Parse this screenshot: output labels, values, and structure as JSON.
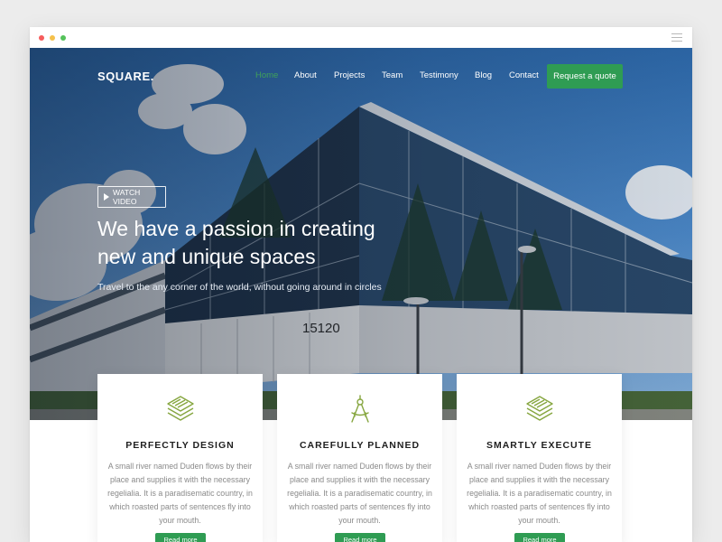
{
  "window": {
    "menu_icon": "hamburger-icon"
  },
  "nav": {
    "logo": "SQUARE.",
    "links": [
      "Home",
      "About",
      "Projects",
      "Team",
      "Testimony",
      "Blog",
      "Contact"
    ],
    "active": "Home",
    "cta": "Request a quote"
  },
  "hero": {
    "watch_video": "WATCH VIDEO",
    "title_line1": "We have a passion in creating",
    "title_line2": "new and unique spaces",
    "subtitle": "Travel to the any corner of the world, without going around in circles",
    "building_number": "15120"
  },
  "features": [
    {
      "icon": "layers-icon",
      "title": "PERFECTLY DESIGN",
      "description": "A small river named Duden flows by their place and supplies it with the necessary regelialia. It is a paradisematic country, in which roasted parts of sentences fly into your mouth.",
      "button": "Read more"
    },
    {
      "icon": "compass-icon",
      "title": "CAREFULLY PLANNED",
      "description": "A small river named Duden flows by their place and supplies it with the necessary regelialia. It is a paradisematic country, in which roasted parts of sentences fly into your mouth.",
      "button": "Read more"
    },
    {
      "icon": "layers-icon",
      "title": "SMARTLY EXECUTE",
      "description": "A small river named Duden flows by their place and supplies it with the necessary regelialia. It is a paradisematic country, in which roasted parts of sentences fly into your mouth.",
      "button": "Read more"
    }
  ],
  "colors": {
    "accent": "#2f9c53",
    "active_link": "#3fa15a",
    "icon": "#86a63f"
  }
}
